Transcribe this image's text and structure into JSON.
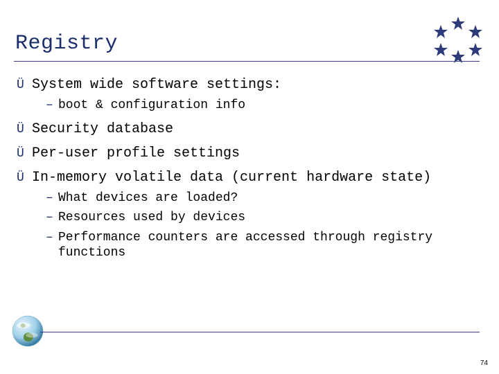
{
  "title": "Registry",
  "bullets": [
    {
      "text": "System wide software settings:",
      "subs": [
        "boot & configuration info"
      ]
    },
    {
      "text": "Security database",
      "subs": []
    },
    {
      "text": "Per-user profile settings",
      "subs": []
    },
    {
      "text": "In-memory volatile data (current hardware state)",
      "subs": [
        "What devices are loaded?",
        "Resources used by devices",
        "Performance counters are accessed through registry functions"
      ]
    }
  ],
  "page_number": "74",
  "colors": {
    "accent": "#1a2e6b",
    "star_fill": "#2e3b7a",
    "rule": "#3b3b8f"
  },
  "icons": {
    "bullet_arrow": "Ü",
    "sub_dash": "–"
  }
}
